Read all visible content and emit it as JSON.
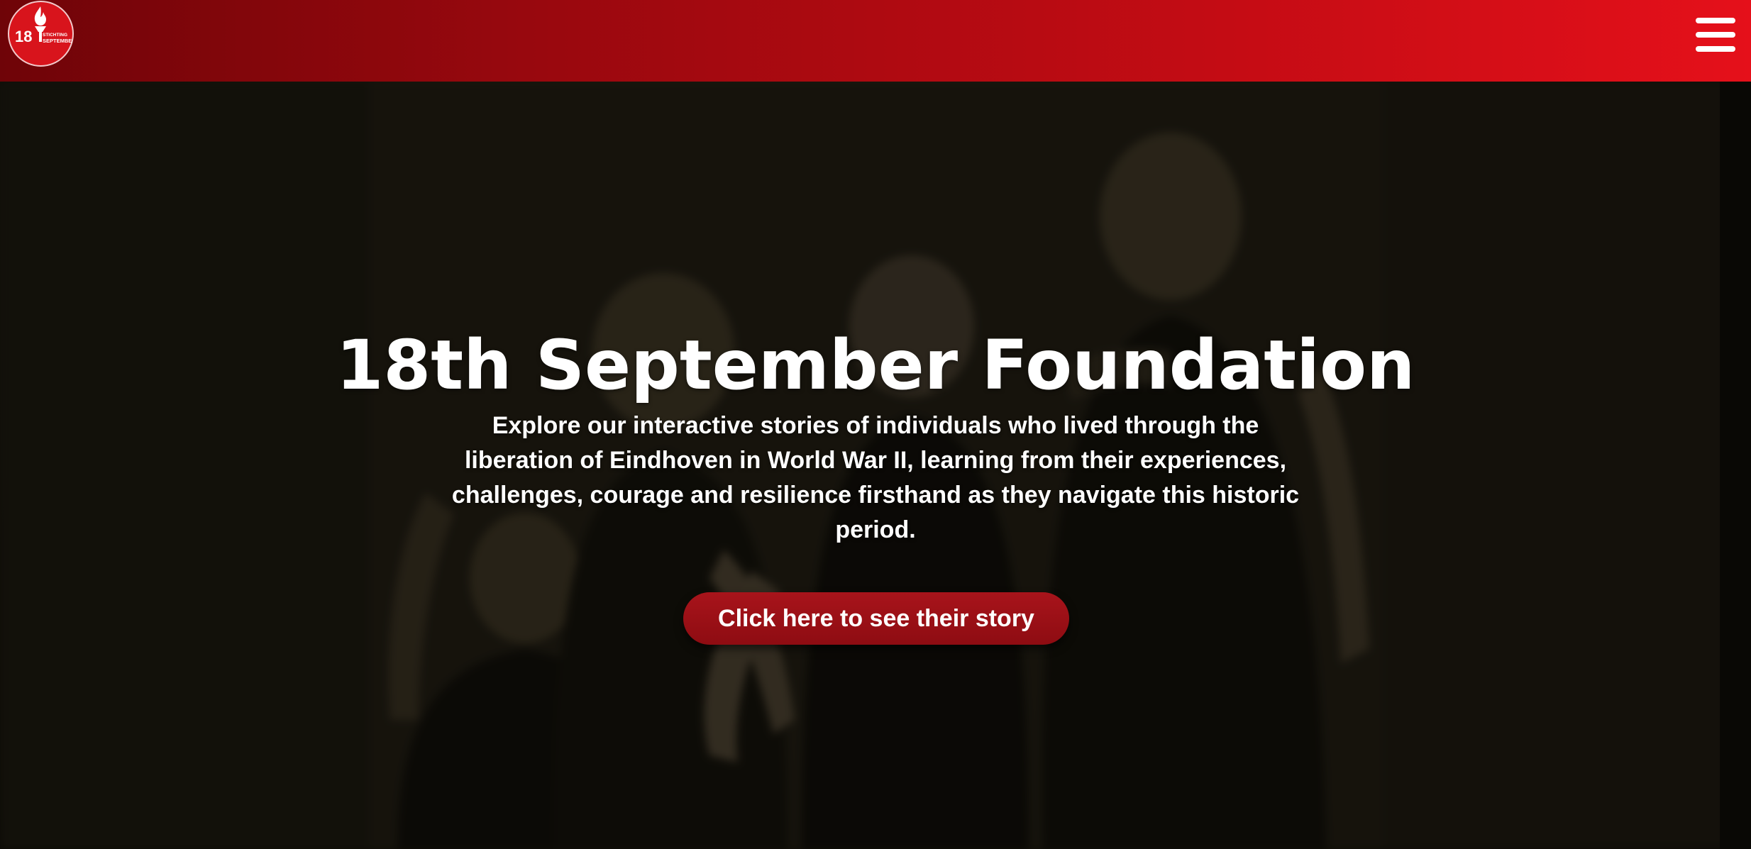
{
  "header": {
    "logo": {
      "icon": "torch-flame-icon",
      "number": "18",
      "line1": "STICHTING",
      "line2": "SEPTEMBER"
    },
    "menu_icon": "hamburger-menu-icon"
  },
  "hero": {
    "title": "18th September Foundation",
    "subtitle": "Explore our interactive stories of individuals who lived through the liberation of Eindhoven in World War II, learning from their experiences, challenges, courage and resilience firsthand as they navigate this historic period.",
    "cta_label": "Click here to see their story",
    "background_image": "blurred-historic-photo-of-children"
  },
  "colors": {
    "navbar_dark": "#6f0408",
    "navbar_light": "#e5101a",
    "logo_red": "#d8141c",
    "button_red": "#9c1017",
    "text": "#ffffff"
  }
}
